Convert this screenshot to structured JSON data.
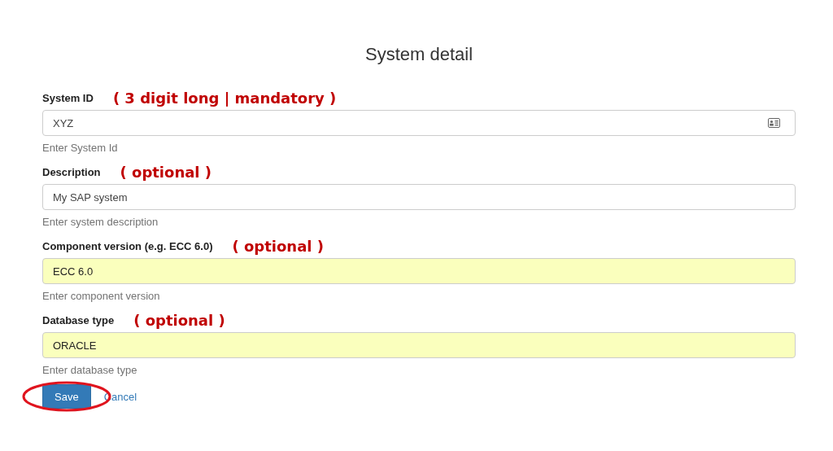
{
  "title": "System detail",
  "fields": [
    {
      "label": "System ID",
      "annotation": "( 3 digit long | mandatory )",
      "value": "XYZ",
      "help": "Enter System Id",
      "autofilled": false,
      "has_icon": true
    },
    {
      "label": "Description",
      "annotation": "( optional )",
      "value": "My SAP system",
      "help": "Enter system description",
      "autofilled": false,
      "has_icon": false
    },
    {
      "label": "Component version (e.g. ECC 6.0)",
      "annotation": "( optional )",
      "value": "ECC 6.0",
      "help": "Enter component version",
      "autofilled": true,
      "has_icon": false
    },
    {
      "label": "Database type",
      "annotation": "( optional )",
      "value": "ORACLE",
      "help": "Enter database type",
      "autofilled": true,
      "has_icon": false
    }
  ],
  "buttons": {
    "save": "Save",
    "cancel": "Cancel",
    "save_circled": true
  }
}
